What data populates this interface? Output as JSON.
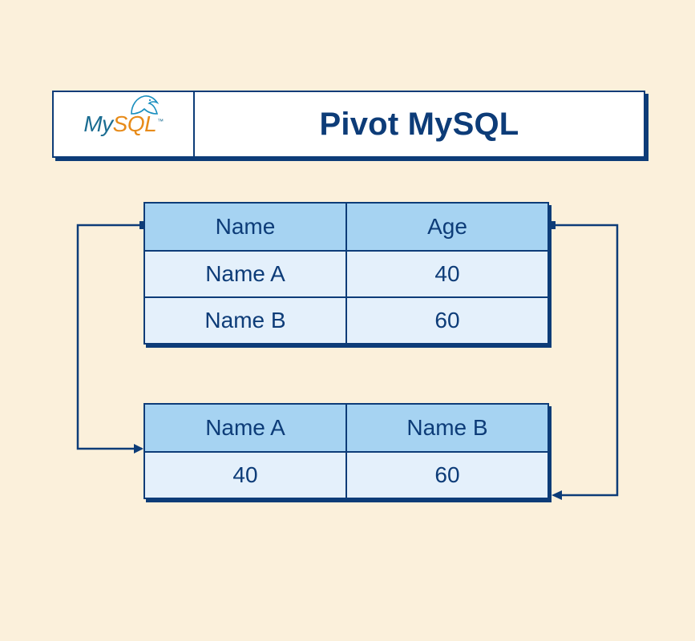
{
  "header": {
    "title": "Pivot MySQL",
    "logo_text_1": "My",
    "logo_text_2": "SQL",
    "logo_tm": "™"
  },
  "table_source": {
    "headers": [
      "Name",
      "Age"
    ],
    "rows": [
      [
        "Name A",
        "40"
      ],
      [
        "Name B",
        "60"
      ]
    ]
  },
  "table_pivot": {
    "headers": [
      "Name A",
      "Name B"
    ],
    "rows": [
      [
        "40",
        "60"
      ]
    ]
  }
}
